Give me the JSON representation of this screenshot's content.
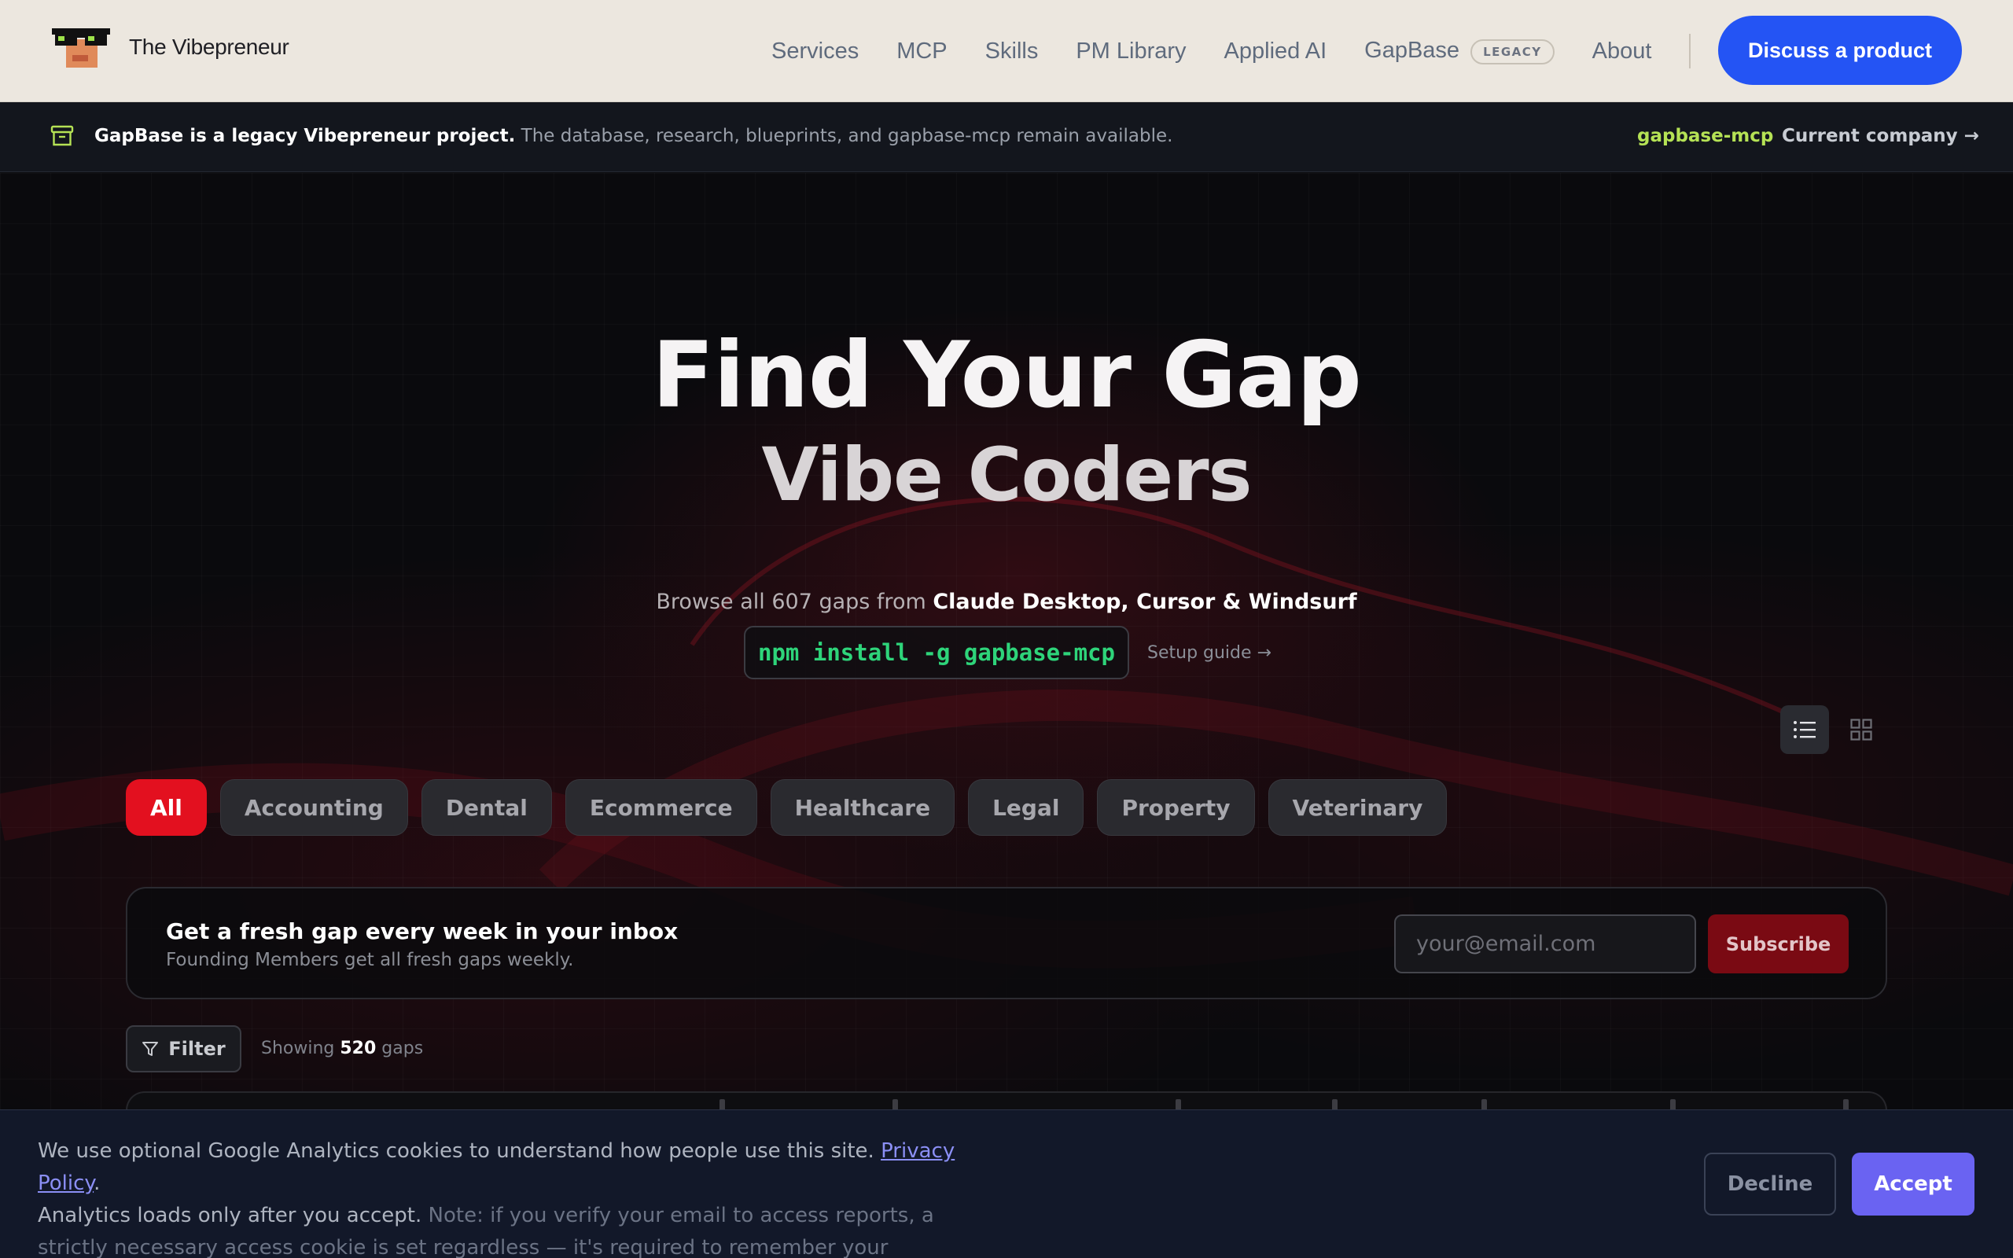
{
  "brand": {
    "name": "The Vibepreneur",
    "logo_icon": "pixel-sunglasses-avatar-icon"
  },
  "nav": {
    "items": [
      "Services",
      "MCP",
      "Skills",
      "PM Library",
      "Applied AI",
      "GapBase",
      "About"
    ],
    "legacy_badge": "LEGACY",
    "cta": "Discuss a product"
  },
  "banner": {
    "icon": "archive-icon",
    "bold": "GapBase is a legacy Vibepreneur project.",
    "text": " The database, research, blueprints, and gapbase-mcp remain available.",
    "link_mcp": "gapbase-mcp",
    "link_company": "Current company",
    "arrow": "→"
  },
  "hero": {
    "title": "Find Your Gap",
    "subtitle": "Vibe Coders",
    "browse_prefix": "Browse all 607 gaps from ",
    "browse_bold": "Claude Desktop, Cursor & Windsurf",
    "npm_command": "npm install -g gapbase-mcp",
    "setup_guide": "Setup guide →"
  },
  "view_toggle": {
    "list_icon": "list-view-icon",
    "grid_icon": "grid-view-icon",
    "active": "list"
  },
  "categories": [
    "All",
    "Accounting",
    "Dental",
    "Ecommerce",
    "Healthcare",
    "Legal",
    "Property",
    "Veterinary"
  ],
  "active_category": "All",
  "subscribe": {
    "title": "Get a fresh gap every week in your inbox",
    "description": "Founding Members get all fresh gaps weekly.",
    "placeholder": "your@email.com",
    "button": "Subscribe"
  },
  "filter": {
    "label": "Filter",
    "icon": "funnel-icon"
  },
  "showing": {
    "prefix": "Showing ",
    "count": "520",
    "suffix": " gaps"
  },
  "cookie": {
    "line1": "We use optional Google Analytics cookies to understand how people use this site. ",
    "policy_link": "Privacy Policy",
    "line1_end": ".",
    "line2": "Analytics loads only after you accept. ",
    "note": "Note: if you verify your email to access reports, a strictly necessary access cookie is set regardless — it's required to remember your access.",
    "decline": "Decline",
    "accept": "Accept"
  },
  "colors": {
    "header_bg": "#ece7df",
    "cta_blue": "#2454f4",
    "accent_red": "#e3101f",
    "npm_green": "#2ed47a",
    "mcp_link_green": "#b5e255",
    "accept_purple": "#6a63f2"
  }
}
